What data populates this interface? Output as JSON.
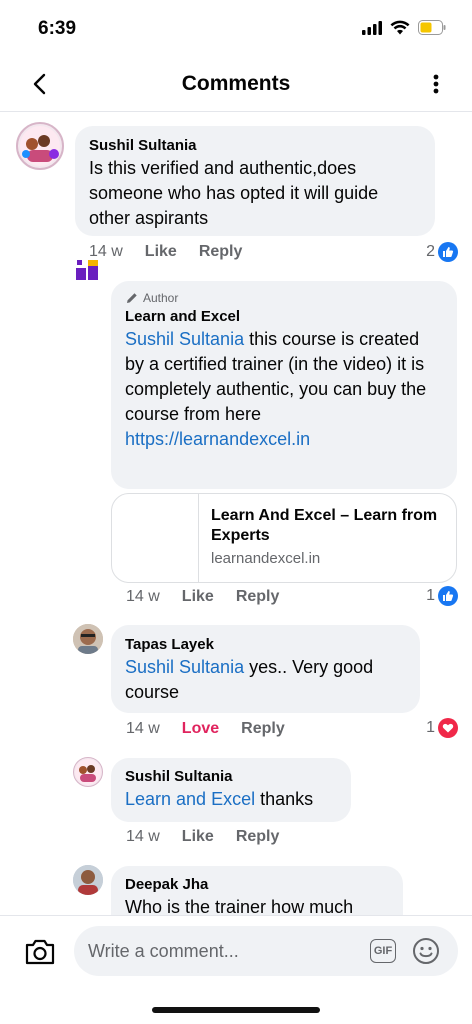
{
  "status": {
    "time": "6:39"
  },
  "header": {
    "title": "Comments"
  },
  "comments": [
    {
      "name": "Sushil Sultania",
      "text": "Is this verified and authentic,does someone who has opted it will guide other aspirants",
      "age": "14 w",
      "action1": "Like",
      "action2": "Reply",
      "reaction_count": "2"
    },
    {
      "tag": "Author",
      "name": "Learn and Excel",
      "mention": "Sushil Sultania",
      "text": " this course is created by a certified trainer (in the video) it is completely authentic, you can buy the course from here",
      "url": "https://learnandexcel.in",
      "preview_title": "Learn And Excel – Learn from Experts",
      "preview_domain": "learnandexcel.in",
      "age": "14 w",
      "action1": "Like",
      "action2": "Reply",
      "reaction_count": "1"
    },
    {
      "name": "Tapas Layek",
      "mention": "Sushil Sultania",
      "text": " yes.. Very good course",
      "age": "14 w",
      "action1": "Love",
      "action2": "Reply",
      "reaction_count": "1"
    },
    {
      "name": "Sushil Sultania",
      "mention": "Learn and Excel",
      "text": " thanks",
      "age": "14 w",
      "action1": "Like",
      "action2": "Reply"
    },
    {
      "name": "Deepak Jha",
      "text": "Who is the trainer how much"
    }
  ],
  "composer": {
    "placeholder": "Write a comment...",
    "gif_label": "GIF"
  },
  "colors": {
    "like_blue": "#1877f2",
    "love_red": "#f02849",
    "link": "#1b6fc4",
    "bubble": "#f0f2f5"
  },
  "icons": [
    "back-icon",
    "more-icon",
    "like-icon",
    "love-icon",
    "pencil-icon",
    "camera-icon",
    "gif-icon",
    "emoji-icon"
  ]
}
